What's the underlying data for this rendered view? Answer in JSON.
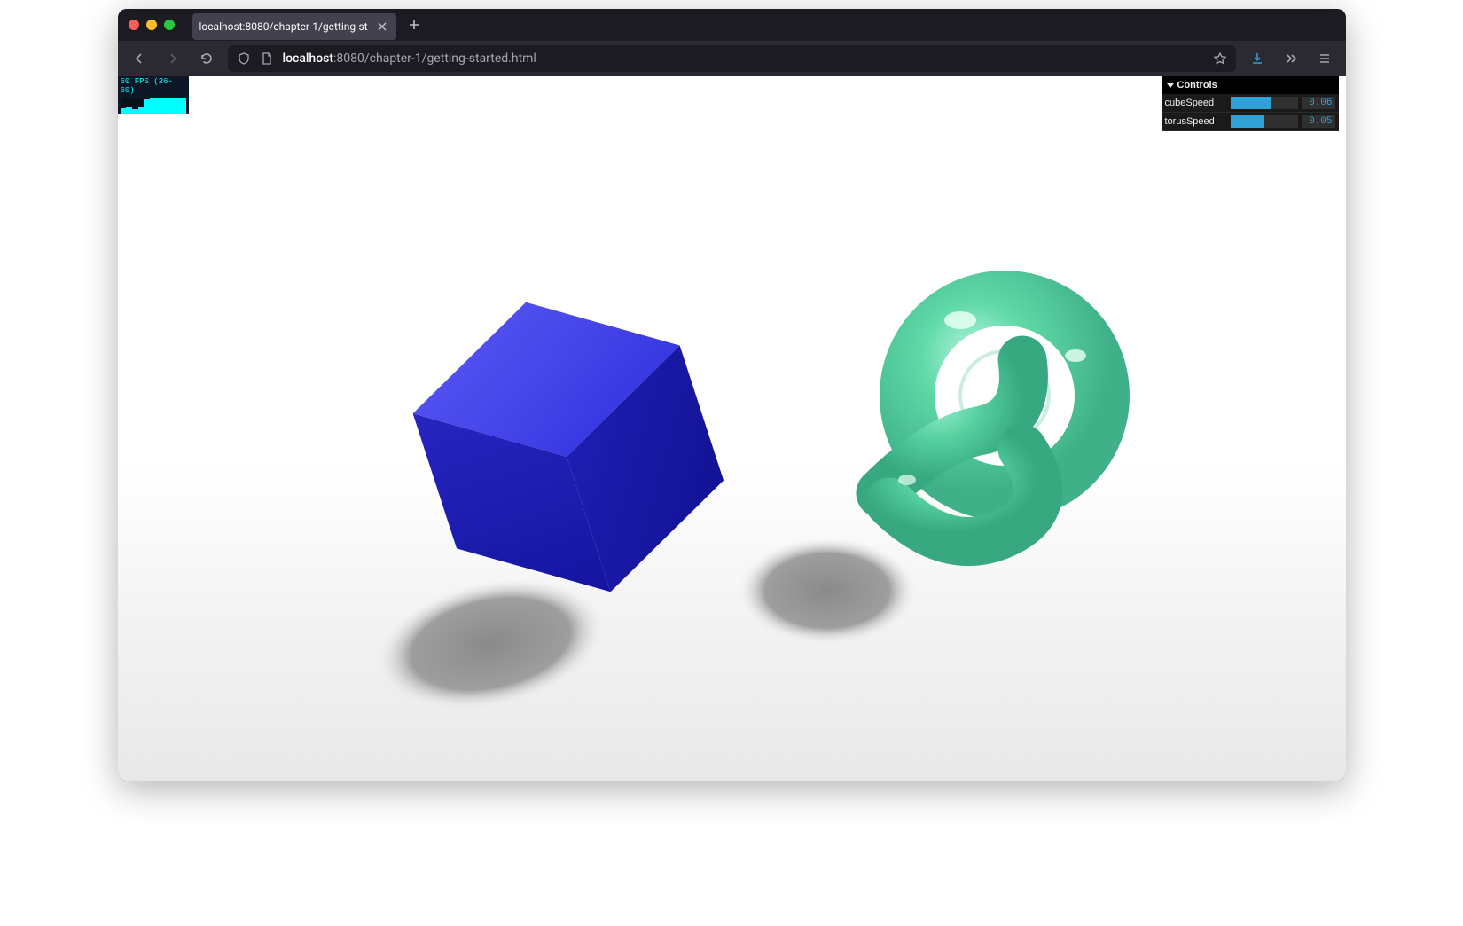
{
  "browser": {
    "tab_title": "localhost:8080/chapter-1/getting-st",
    "url_host": "localhost",
    "url_port_path": ":8080/chapter-1/getting-started.html"
  },
  "stats": {
    "fps_line": "60 FPS (26-60)"
  },
  "gui": {
    "title": "Controls",
    "rows": [
      {
        "label": "cubeSpeed",
        "value": "0.06",
        "fill_pct": 60
      },
      {
        "label": "torusSpeed",
        "value": "0.05",
        "fill_pct": 50
      }
    ]
  },
  "scene": {
    "cube_color": "#2f2fdd",
    "cube_highlight": "#4a4af0",
    "cube_dark": "#1a1a9e",
    "torus_color": "#5fd9a8",
    "torus_highlight": "#a8f0d4",
    "torus_shadow": "#3fb088",
    "shadow_color": "#9e9e9e"
  }
}
